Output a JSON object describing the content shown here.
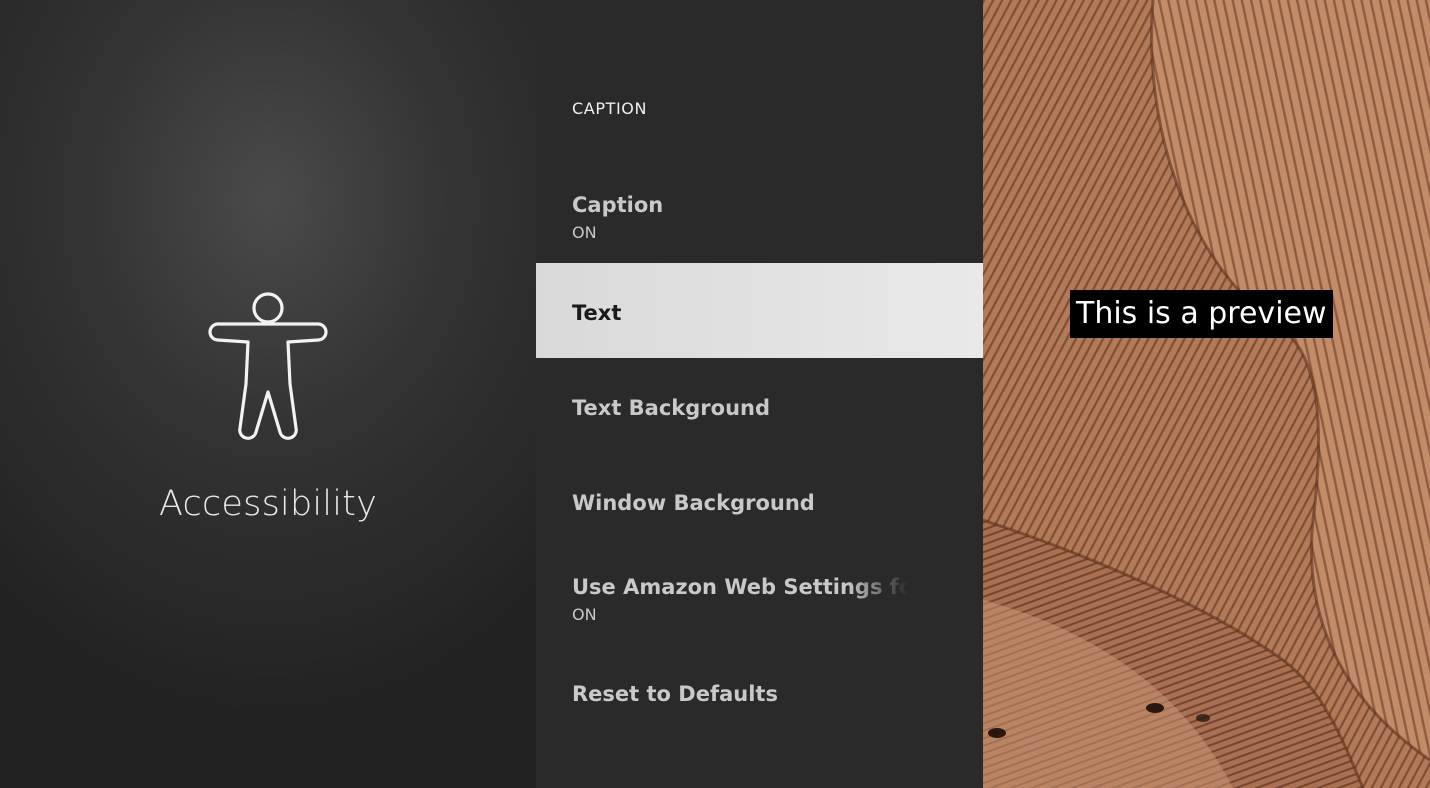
{
  "category": {
    "title": "Accessibility",
    "icon": "accessibility-person-icon"
  },
  "menu": {
    "header": "CAPTION",
    "items": [
      {
        "label": "Caption",
        "value": "ON"
      },
      {
        "label": "Text",
        "selected": true
      },
      {
        "label": "Text Background"
      },
      {
        "label": "Window Background"
      },
      {
        "label": "Use Amazon Web Settings for Live",
        "value": "ON"
      },
      {
        "label": "Reset to Defaults"
      }
    ]
  },
  "preview": {
    "caption_text": "This is a preview",
    "caption_bg_color": "#000000",
    "caption_text_color": "#ffffff"
  },
  "colors": {
    "menu_bg": "#2a2a2a",
    "selected_bg": "#e5e5e5",
    "menu_text": "#c9c9c9"
  }
}
